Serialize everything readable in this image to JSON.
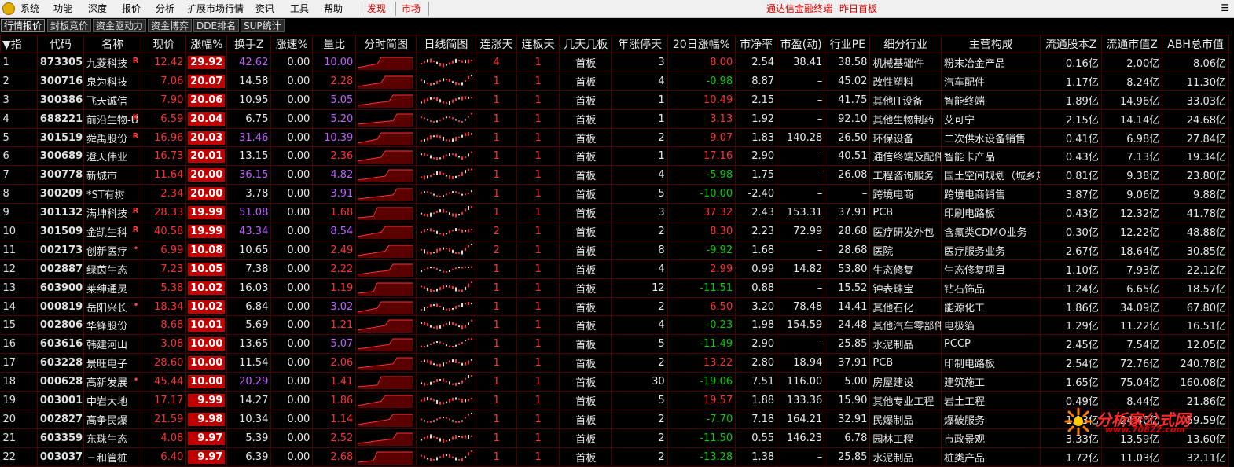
{
  "menubar": {
    "items": [
      "系统",
      "功能",
      "深度",
      "报价",
      "分析",
      "扩展市场行情",
      "资讯",
      "工具",
      "帮助"
    ],
    "discover": "发现",
    "market": "市场",
    "app_title": "通达信金融终端",
    "window_title": "昨日首板"
  },
  "tabs": [
    "行情报价",
    "封板竞价",
    "资金驱动力",
    "资金博弈",
    "DDE排名",
    "SUP统计"
  ],
  "columns": [
    "▼指",
    "代码",
    "名称",
    "现价",
    "涨幅%",
    "换手Z",
    "涨速%",
    "量比",
    "分时简图",
    "日线简图",
    "连涨天",
    "连板天",
    "几天几板",
    "年涨停天",
    "20日涨幅%",
    "市净率",
    "市盈(动)",
    "行业PE",
    "细分行业",
    "主营构成",
    "流通股本Z",
    "流通市值Z",
    "ABH总市值"
  ],
  "rows": [
    {
      "idx": "1",
      "code": "873305",
      "name": "九菱科技",
      "flag": "R",
      "price": "12.42",
      "chg": "29.92",
      "turnover": "42.62",
      "speed": "0.00",
      "vol_ratio": "10.00",
      "up_days": "4",
      "limit_days": "1",
      "board": "首板",
      "year_limit": "3",
      "chg20": "8.00",
      "pb": "2.54",
      "pe": "38.41",
      "ind_pe": "38.58",
      "industry": "机械基础件",
      "business": "粉末冶金产品",
      "float_shares": "0.16亿",
      "float_mv": "2.00亿",
      "total_mv": "8.06亿"
    },
    {
      "idx": "2",
      "code": "300716",
      "name": "泉为科技",
      "flag": "",
      "price": "7.06",
      "chg": "20.07",
      "turnover": "14.58",
      "speed": "0.00",
      "vol_ratio": "2.28",
      "up_days": "1",
      "limit_days": "1",
      "board": "首板",
      "year_limit": "4",
      "chg20": "-0.98",
      "pb": "8.87",
      "pe": "–",
      "ind_pe": "45.02",
      "industry": "改性塑料",
      "business": "汽车配件",
      "float_shares": "1.17亿",
      "float_mv": "8.24亿",
      "total_mv": "11.30亿"
    },
    {
      "idx": "3",
      "code": "300386",
      "name": "飞天诚信",
      "flag": "",
      "price": "7.90",
      "chg": "20.06",
      "turnover": "10.95",
      "speed": "0.00",
      "vol_ratio": "5.05",
      "up_days": "1",
      "limit_days": "1",
      "board": "首板",
      "year_limit": "1",
      "chg20": "10.49",
      "pb": "2.15",
      "pe": "–",
      "ind_pe": "41.75",
      "industry": "其他IT设备",
      "business": "智能终端",
      "float_shares": "1.89亿",
      "float_mv": "14.96亿",
      "total_mv": "33.03亿"
    },
    {
      "idx": "4",
      "code": "688221",
      "name": "前沿生物-U",
      "flag": "K",
      "price": "6.59",
      "chg": "20.04",
      "turnover": "6.75",
      "speed": "0.00",
      "vol_ratio": "5.20",
      "up_days": "1",
      "limit_days": "1",
      "board": "首板",
      "year_limit": "1",
      "chg20": "3.13",
      "pb": "1.92",
      "pe": "–",
      "ind_pe": "92.10",
      "industry": "其他生物制药",
      "business": "艾可宁",
      "float_shares": "2.15亿",
      "float_mv": "14.14亿",
      "total_mv": "24.68亿"
    },
    {
      "idx": "5",
      "code": "301519",
      "name": "舜禹股份",
      "flag": "R",
      "price": "16.96",
      "chg": "20.03",
      "turnover": "31.46",
      "speed": "0.00",
      "vol_ratio": "10.39",
      "up_days": "1",
      "limit_days": "1",
      "board": "首板",
      "year_limit": "2",
      "chg20": "9.07",
      "pb": "1.83",
      "pe": "140.28",
      "ind_pe": "26.50",
      "industry": "环保设备",
      "business": "二次供水设备销售",
      "float_shares": "0.41亿",
      "float_mv": "6.98亿",
      "total_mv": "27.84亿"
    },
    {
      "idx": "6",
      "code": "300689",
      "name": "澄天伟业",
      "flag": "",
      "price": "16.73",
      "chg": "20.01",
      "turnover": "13.15",
      "speed": "0.00",
      "vol_ratio": "2.36",
      "up_days": "1",
      "limit_days": "1",
      "board": "首板",
      "year_limit": "1",
      "chg20": "17.16",
      "pb": "2.90",
      "pe": "–",
      "ind_pe": "40.51",
      "industry": "通信终端及配件",
      "business": "智能卡产品",
      "float_shares": "0.43亿",
      "float_mv": "7.13亿",
      "total_mv": "19.34亿"
    },
    {
      "idx": "7",
      "code": "300778",
      "name": "新城市",
      "flag": "",
      "price": "11.64",
      "chg": "20.00",
      "turnover": "36.15",
      "speed": "0.00",
      "vol_ratio": "4.82",
      "up_days": "1",
      "limit_days": "1",
      "board": "首板",
      "year_limit": "4",
      "chg20": "-5.98",
      "pb": "1.75",
      "pe": "–",
      "ind_pe": "26.08",
      "industry": "工程咨询服务",
      "business": "国土空间规划（城乡规",
      "float_shares": "0.81亿",
      "float_mv": "9.38亿",
      "total_mv": "23.80亿"
    },
    {
      "idx": "8",
      "code": "300209",
      "name": "*ST有树",
      "flag": "",
      "price": "2.34",
      "chg": "20.00",
      "turnover": "3.78",
      "speed": "0.00",
      "vol_ratio": "3.91",
      "up_days": "1",
      "limit_days": "1",
      "board": "首板",
      "year_limit": "5",
      "chg20": "-10.00",
      "pb": "-2.40",
      "pe": "–",
      "ind_pe": "–",
      "industry": "跨境电商",
      "business": "跨境电商销售",
      "float_shares": "3.87亿",
      "float_mv": "9.06亿",
      "total_mv": "9.88亿"
    },
    {
      "idx": "9",
      "code": "301132",
      "name": "满坤科技",
      "flag": "R",
      "price": "28.33",
      "chg": "19.99",
      "turnover": "51.08",
      "speed": "0.00",
      "vol_ratio": "1.68",
      "up_days": "1",
      "limit_days": "1",
      "board": "首板",
      "year_limit": "3",
      "chg20": "37.32",
      "pb": "2.43",
      "pe": "153.31",
      "ind_pe": "37.91",
      "industry": "PCB",
      "business": "印刷电路板",
      "float_shares": "0.43亿",
      "float_mv": "12.32亿",
      "total_mv": "41.78亿"
    },
    {
      "idx": "10",
      "code": "301509",
      "name": "金凯生科",
      "flag": "R",
      "price": "40.58",
      "chg": "19.99",
      "turnover": "43.34",
      "speed": "0.00",
      "vol_ratio": "8.54",
      "up_days": "2",
      "limit_days": "1",
      "board": "首板",
      "year_limit": "2",
      "chg20": "8.30",
      "pb": "2.23",
      "pe": "72.99",
      "ind_pe": "28.68",
      "industry": "医疗研发外包",
      "business": "含氟类CDMO业务",
      "float_shares": "0.30亿",
      "float_mv": "12.22亿",
      "total_mv": "48.88亿"
    },
    {
      "idx": "11",
      "code": "002173",
      "name": "创新医疗",
      "flag": "•",
      "price": "6.99",
      "chg": "10.08",
      "turnover": "10.65",
      "speed": "0.00",
      "vol_ratio": "2.49",
      "up_days": "2",
      "limit_days": "1",
      "board": "首板",
      "year_limit": "8",
      "chg20": "-9.92",
      "pb": "1.68",
      "pe": "–",
      "ind_pe": "28.68",
      "industry": "医院",
      "business": "医疗服务业务",
      "float_shares": "2.67亿",
      "float_mv": "18.64亿",
      "total_mv": "30.85亿"
    },
    {
      "idx": "12",
      "code": "002887",
      "name": "绿茵生态",
      "flag": "",
      "price": "7.23",
      "chg": "10.05",
      "turnover": "7.38",
      "speed": "0.00",
      "vol_ratio": "2.22",
      "up_days": "1",
      "limit_days": "1",
      "board": "首板",
      "year_limit": "4",
      "chg20": "2.99",
      "pb": "0.99",
      "pe": "14.82",
      "ind_pe": "53.80",
      "industry": "生态修复",
      "business": "生态修复项目",
      "float_shares": "1.10亿",
      "float_mv": "7.93亿",
      "total_mv": "22.12亿"
    },
    {
      "idx": "13",
      "code": "603900",
      "name": "莱绅通灵",
      "flag": "",
      "price": "5.38",
      "chg": "10.02",
      "turnover": "16.03",
      "speed": "0.00",
      "vol_ratio": "1.19",
      "up_days": "1",
      "limit_days": "1",
      "board": "首板",
      "year_limit": "12",
      "chg20": "-11.51",
      "pb": "0.88",
      "pe": "–",
      "ind_pe": "15.52",
      "industry": "钟表珠宝",
      "business": "钻石饰品",
      "float_shares": "1.24亿",
      "float_mv": "6.65亿",
      "total_mv": "18.57亿"
    },
    {
      "idx": "14",
      "code": "000819",
      "name": "岳阳兴长",
      "flag": "•",
      "price": "18.34",
      "chg": "10.02",
      "turnover": "6.84",
      "speed": "0.00",
      "vol_ratio": "3.02",
      "up_days": "1",
      "limit_days": "1",
      "board": "首板",
      "year_limit": "2",
      "chg20": "6.50",
      "pb": "3.20",
      "pe": "78.48",
      "ind_pe": "14.41",
      "industry": "其他石化",
      "business": "能源化工",
      "float_shares": "1.86亿",
      "float_mv": "34.09亿",
      "total_mv": "67.80亿"
    },
    {
      "idx": "15",
      "code": "002806",
      "name": "华锋股份",
      "flag": "",
      "price": "8.68",
      "chg": "10.01",
      "turnover": "5.69",
      "speed": "0.00",
      "vol_ratio": "1.21",
      "up_days": "1",
      "limit_days": "1",
      "board": "首板",
      "year_limit": "4",
      "chg20": "-0.23",
      "pb": "1.98",
      "pe": "154.59",
      "ind_pe": "24.48",
      "industry": "其他汽车零部件",
      "business": "电极箔",
      "float_shares": "1.29亿",
      "float_mv": "11.22亿",
      "total_mv": "16.51亿"
    },
    {
      "idx": "16",
      "code": "603616",
      "name": "韩建河山",
      "flag": "",
      "price": "3.08",
      "chg": "10.00",
      "turnover": "13.65",
      "speed": "0.00",
      "vol_ratio": "5.07",
      "up_days": "1",
      "limit_days": "1",
      "board": "首板",
      "year_limit": "5",
      "chg20": "-11.49",
      "pb": "2.90",
      "pe": "–",
      "ind_pe": "25.85",
      "industry": "水泥制品",
      "business": "PCCP",
      "float_shares": "2.45亿",
      "float_mv": "7.54亿",
      "total_mv": "12.05亿"
    },
    {
      "idx": "17",
      "code": "603228",
      "name": "景旺电子",
      "flag": "",
      "price": "28.60",
      "chg": "10.00",
      "turnover": "11.54",
      "speed": "0.00",
      "vol_ratio": "2.06",
      "up_days": "1",
      "limit_days": "1",
      "board": "首板",
      "year_limit": "2",
      "chg20": "13.22",
      "pb": "2.80",
      "pe": "18.94",
      "ind_pe": "37.91",
      "industry": "PCB",
      "business": "印制电路板",
      "float_shares": "2.54亿",
      "float_mv": "72.76亿",
      "total_mv": "240.78亿"
    },
    {
      "idx": "18",
      "code": "000628",
      "name": "高新发展",
      "flag": "•",
      "price": "45.44",
      "chg": "10.00",
      "turnover": "20.29",
      "speed": "0.00",
      "vol_ratio": "1.41",
      "up_days": "1",
      "limit_days": "1",
      "board": "首板",
      "year_limit": "30",
      "chg20": "-19.06",
      "pb": "7.51",
      "pe": "116.00",
      "ind_pe": "5.00",
      "industry": "房屋建设",
      "business": "建筑施工",
      "float_shares": "1.65亿",
      "float_mv": "75.04亿",
      "total_mv": "160.08亿"
    },
    {
      "idx": "19",
      "code": "003001",
      "name": "中岩大地",
      "flag": "",
      "price": "17.17",
      "chg": "9.99",
      "turnover": "14.27",
      "speed": "0.00",
      "vol_ratio": "1.86",
      "up_days": "1",
      "limit_days": "1",
      "board": "首板",
      "year_limit": "5",
      "chg20": "19.57",
      "pb": "1.88",
      "pe": "133.36",
      "ind_pe": "15.90",
      "industry": "其他专业工程",
      "business": "岩土工程",
      "float_shares": "0.49亿",
      "float_mv": "8.44亿",
      "total_mv": "21.86亿"
    },
    {
      "idx": "20",
      "code": "002827",
      "name": "高争民爆",
      "flag": "",
      "price": "21.59",
      "chg": "9.98",
      "turnover": "10.34",
      "speed": "0.00",
      "vol_ratio": "1.14",
      "up_days": "1",
      "limit_days": "1",
      "board": "首板",
      "year_limit": "2",
      "chg20": "-7.70",
      "pb": "7.18",
      "pe": "164.21",
      "ind_pe": "32.91",
      "industry": "民爆制品",
      "business": "爆破服务",
      "float_shares": "1.13亿",
      "float_mv": "24.40亿",
      "total_mv": "59.59亿"
    },
    {
      "idx": "21",
      "code": "603359",
      "name": "东珠生态",
      "flag": "",
      "price": "4.08",
      "chg": "9.97",
      "turnover": "5.39",
      "speed": "0.00",
      "vol_ratio": "2.52",
      "up_days": "1",
      "limit_days": "1",
      "board": "首板",
      "year_limit": "2",
      "chg20": "-11.50",
      "pb": "0.55",
      "pe": "146.23",
      "ind_pe": "6.78",
      "industry": "园林工程",
      "business": "市政景观",
      "float_shares": "3.33亿",
      "float_mv": "13.59亿",
      "total_mv": "13.60亿"
    },
    {
      "idx": "22",
      "code": "003037",
      "name": "三和管桩",
      "flag": "",
      "price": "6.40",
      "chg": "9.97",
      "turnover": "6.39",
      "speed": "0.00",
      "vol_ratio": "2.68",
      "up_days": "1",
      "limit_days": "1",
      "board": "首板",
      "year_limit": "2",
      "chg20": "-13.28",
      "pb": "1.38",
      "pe": "–",
      "ind_pe": "25.85",
      "industry": "水泥制品",
      "business": "桩类产品",
      "float_shares": "1.72亿",
      "float_mv": "11.03亿",
      "total_mv": "32.11亿"
    }
  ],
  "watermark": {
    "brand": "分析家公式网",
    "url": "www.70822.com"
  },
  "colors": {
    "up": "#ff3030",
    "down": "#00d000",
    "turnover_high": "#c060ff",
    "chg_bg": "#c00000",
    "grid": "#4a0000"
  }
}
